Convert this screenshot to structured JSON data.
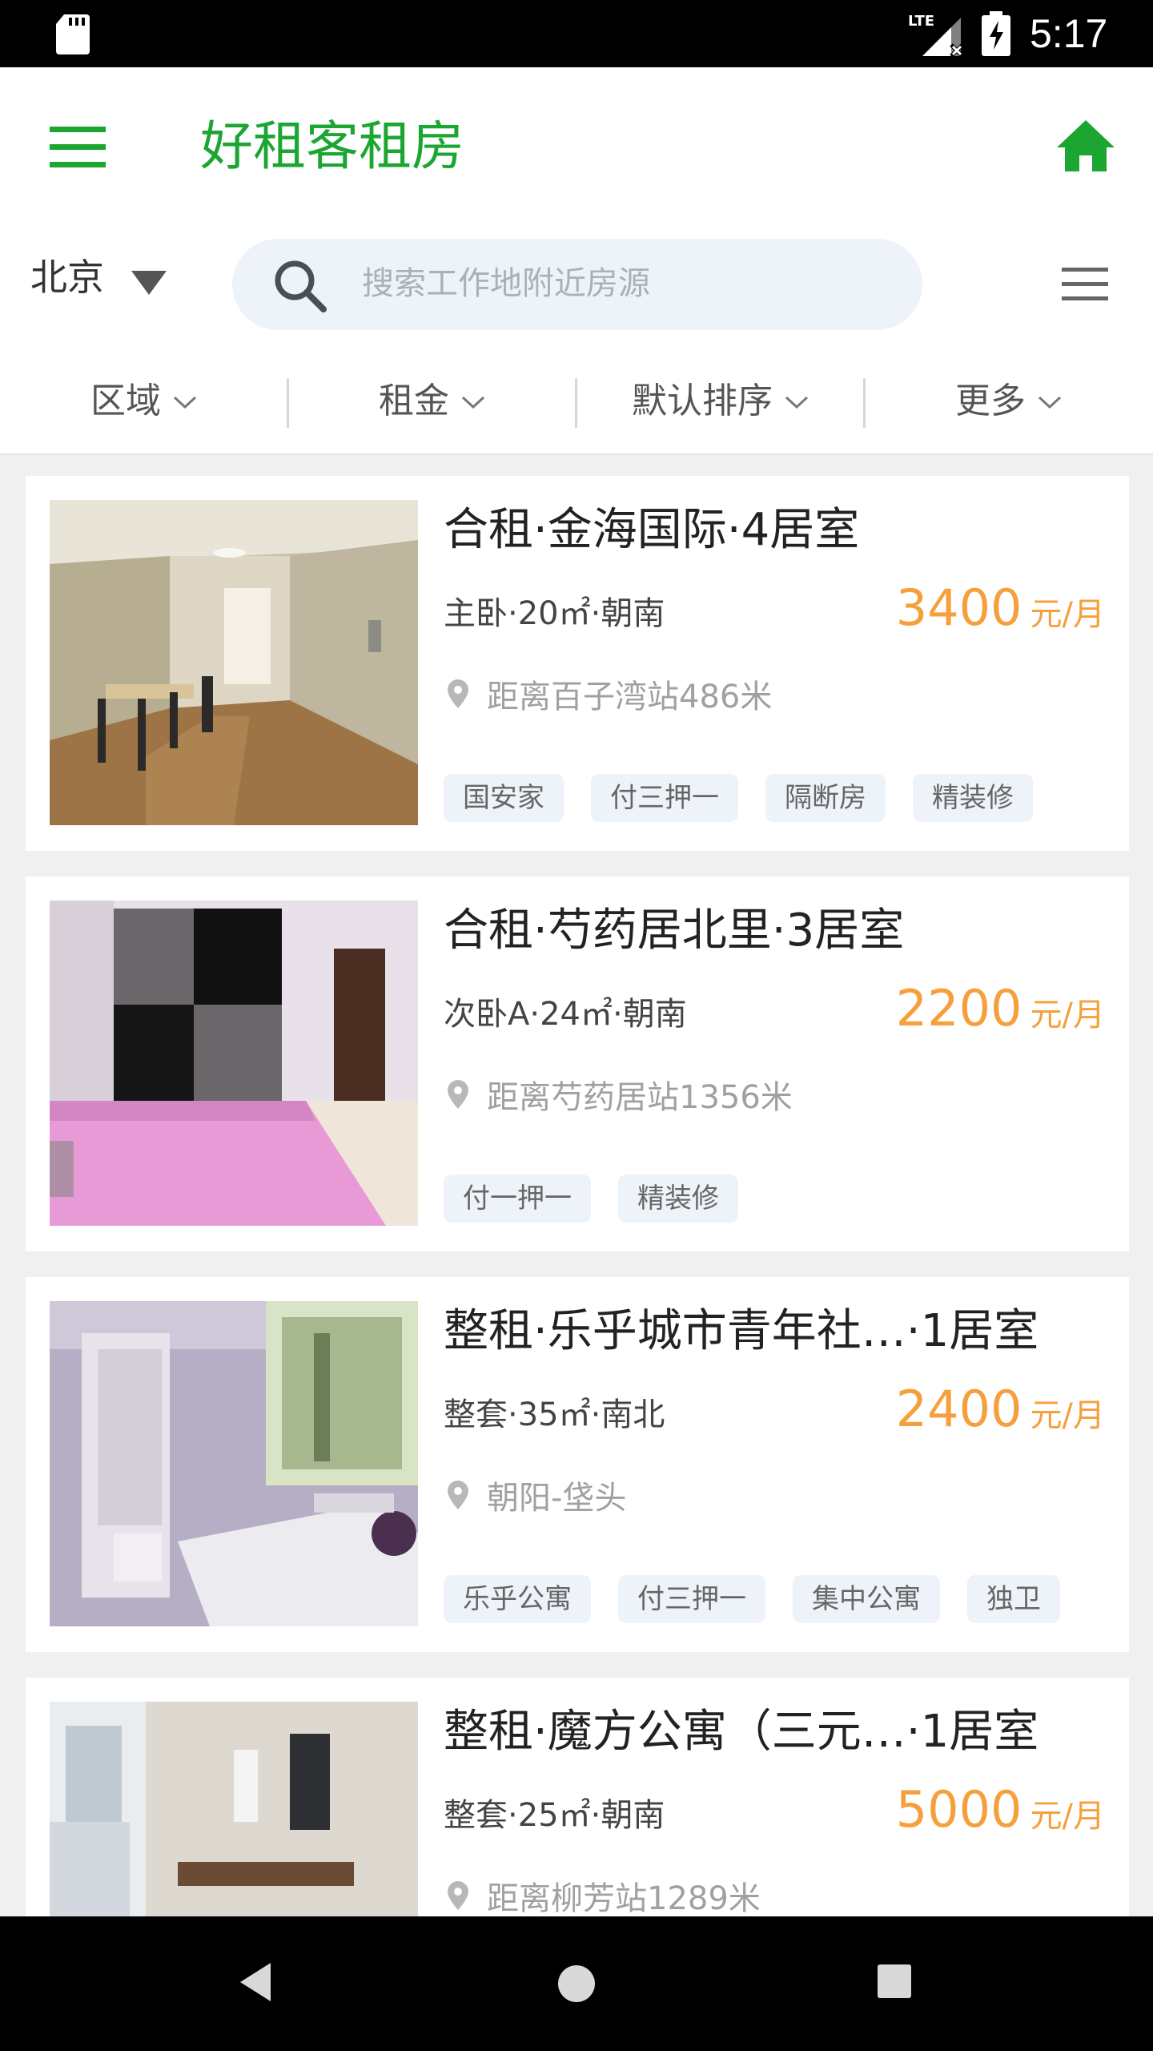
{
  "status_bar": {
    "time": "5:17",
    "network": "LTE",
    "icons": [
      "sd-card-icon",
      "lte-signal-icon",
      "battery-charging-icon"
    ]
  },
  "app_bar": {
    "title": "好租客租房",
    "left_icon": "menu-icon",
    "right_icon": "home-icon",
    "accent_color": "#1aa631"
  },
  "search": {
    "city": "北京",
    "placeholder": "搜索工作地附近房源"
  },
  "filters": [
    {
      "label": "区域"
    },
    {
      "label": "租金"
    },
    {
      "label": "默认排序"
    },
    {
      "label": "更多"
    }
  ],
  "listings": [
    {
      "title": "合租·金海国际·4居室",
      "spec": "主卧·20㎡·朝南",
      "price": "3400",
      "unit": "元/月",
      "location": "距离百子湾站486米",
      "tags": [
        "国安家",
        "付三押一",
        "隔断房",
        "精装修"
      ]
    },
    {
      "title": "合租·芍药居北里·3居室",
      "spec": "次卧A·24㎡·朝南",
      "price": "2200",
      "unit": "元/月",
      "location": "距离芍药居站1356米",
      "tags": [
        "付一押一",
        "精装修"
      ]
    },
    {
      "title": "整租·乐乎城市青年社…·1居室",
      "spec": "整套·35㎡·南北",
      "price": "2400",
      "unit": "元/月",
      "location": "朝阳-垡头",
      "tags": [
        "乐乎公寓",
        "付三押一",
        "集中公寓",
        "独卫"
      ]
    },
    {
      "title": "整租·魔方公寓（三元…·1居室",
      "spec": "整套·25㎡·朝南",
      "price": "5000",
      "unit": "元/月",
      "location": "距离柳芳站1289米",
      "tags": []
    }
  ],
  "colors": {
    "price": "#f5a03c",
    "tag_bg": "#eef3f9",
    "background": "#f0f0f0"
  }
}
